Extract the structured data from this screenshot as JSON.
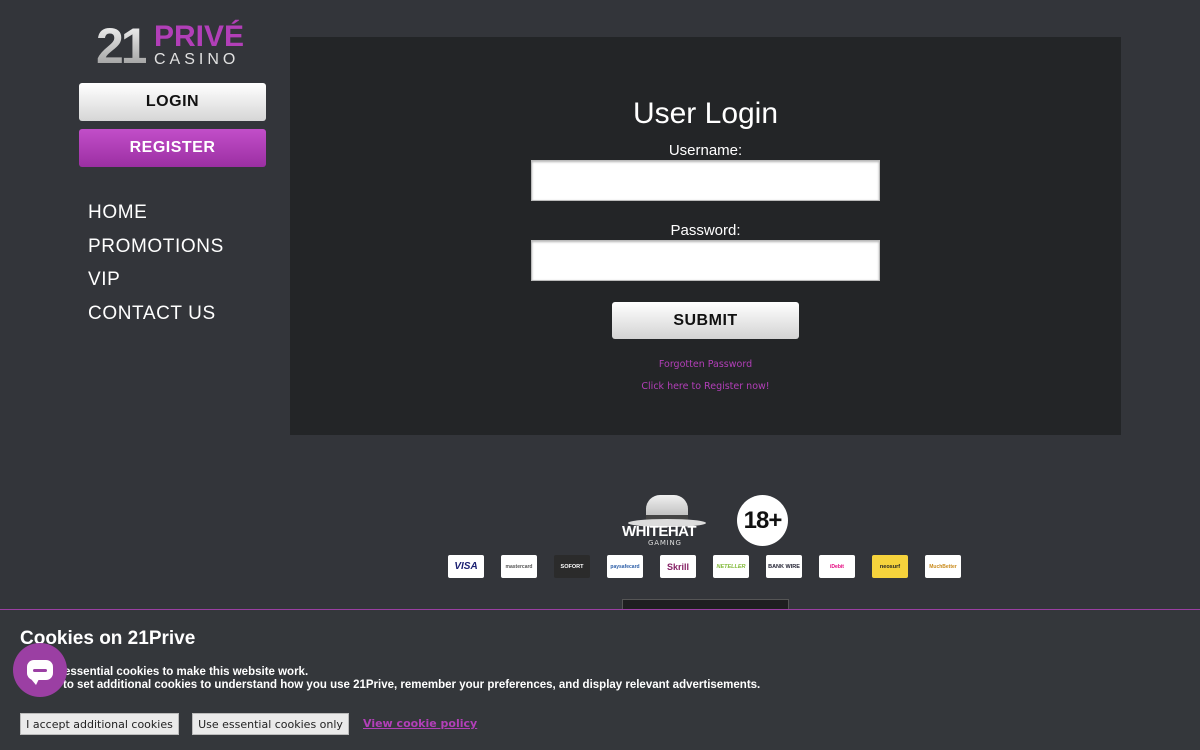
{
  "logo": {
    "number": "21",
    "brand": "PRIVÉ",
    "sub": "CASINO"
  },
  "sidebar": {
    "login_label": "LOGIN",
    "register_label": "REGISTER",
    "nav": [
      "HOME",
      "PROMOTIONS",
      "VIP",
      "CONTACT US"
    ]
  },
  "login": {
    "title": "User Login",
    "username_label": "Username:",
    "password_label": "Password:",
    "submit_label": "SUBMIT",
    "forgot_link": "Forgotten Password",
    "register_link": "Click here to Register now!"
  },
  "footer": {
    "whitehat_text": "WHITEHAT",
    "whitehat_sub": "GAMING",
    "age_badge": "18+",
    "payments": [
      "VISA",
      "mastercard",
      "SOFORT",
      "paysafecard",
      "Skrill",
      "NETELLER",
      "BANK WIRE",
      "iDebit",
      "neosurf",
      "MuchBetter"
    ]
  },
  "cookie_banner": {
    "title": "Cookies on 21Prive",
    "line1": "essential cookies to make this website work.",
    "line2": "ke to set additional cookies to understand how you use 21Prive, remember your preferences, and display relevant advertisements.",
    "accept_label": "I accept additional cookies",
    "essential_label": "Use essential cookies only",
    "policy_link": "View cookie policy"
  },
  "colors": {
    "accent": "#b23fb8",
    "background": "#33353a",
    "panel": "#232527"
  }
}
